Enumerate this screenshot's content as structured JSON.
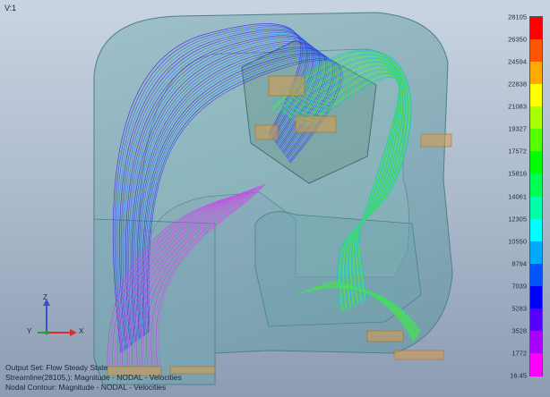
{
  "viewport": {
    "view_label": "V:1",
    "output_info": [
      "Output Set: Flow Steady State",
      "Streamline(28105,): Magnitude - NODAL - Velocities",
      "Nodal Contour: Magnitude - NODAL - Velocities"
    ]
  },
  "legend": {
    "labels": [
      "28105",
      "26350",
      "24594",
      "22838",
      "21083",
      "19327",
      "17572",
      "15816",
      "14061",
      "12305",
      "10550",
      "8794",
      "7039",
      "5283",
      "3528",
      "1772",
      "16.45"
    ],
    "colors": [
      "#ff0000",
      "#ff5500",
      "#ffaa00",
      "#ffff00",
      "#aaff00",
      "#55ff00",
      "#00ff00",
      "#00ff55",
      "#00ffaa",
      "#00ffff",
      "#00aaff",
      "#0055ff",
      "#0000ff",
      "#5500ff",
      "#aa00ff",
      "#ff00ff"
    ]
  },
  "triad": {
    "z_label": "Z",
    "y_label": "Y",
    "x_label": "X"
  }
}
